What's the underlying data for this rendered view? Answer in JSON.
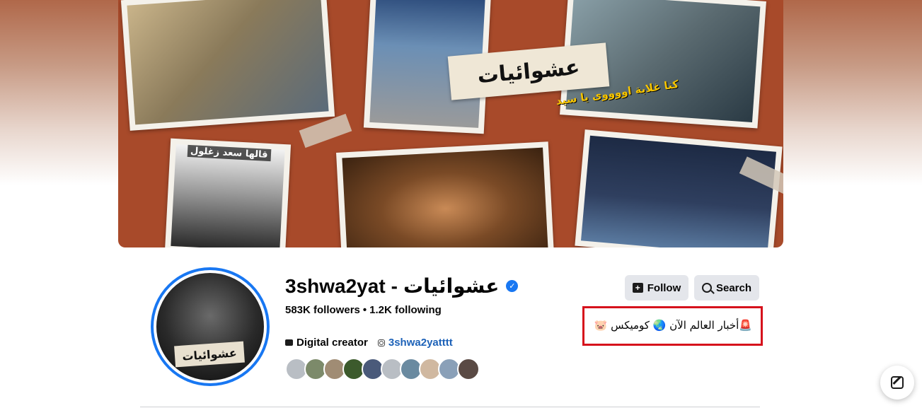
{
  "cover": {
    "title": "عشوائيات",
    "caption_yellow": "كنا غلابة اووووى يا سيد",
    "caption_white": "قالها سعد زغلول"
  },
  "profile": {
    "avatar_label": "عشوائيات",
    "name_latin": "3shwa2yat",
    "name_sep": "-",
    "name_arabic": "عشوائيات",
    "followers": "583K followers",
    "following": "1.2K following",
    "category": "Digital creator",
    "instagram": "3shwa2yatttt"
  },
  "actions": {
    "follow_label": "Follow",
    "search_label": "Search"
  },
  "bio": {
    "text": "🚨أخبار العالم الآن 🌏 كوميكس 🐷"
  },
  "friends": {
    "colors": [
      "#b9bec4",
      "#7c8a6a",
      "#a08c74",
      "#3c5a2c",
      "#4a5a7a",
      "#b9bec4",
      "#6a8aa0",
      "#d0b8a0",
      "#8aa0b8",
      "#5a4a44"
    ]
  },
  "colors": {
    "accent": "#1877f2",
    "highlight_box": "#d6121c",
    "link": "#1d62b8"
  }
}
